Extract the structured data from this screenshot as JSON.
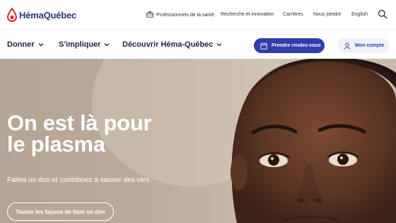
{
  "brand": {
    "name": "HémaQuébec",
    "color": "#23357e",
    "accent": "#d72638"
  },
  "utility_nav": {
    "items": [
      {
        "label": "Professionnels de la santé",
        "icon": "briefcase-icon"
      },
      {
        "label": "Recherche et innovation"
      },
      {
        "label": "Carrières"
      },
      {
        "label": "Nous joindre"
      },
      {
        "label": "English"
      }
    ],
    "search_icon": "search-icon"
  },
  "main_nav": {
    "items": [
      {
        "label": "Donner"
      },
      {
        "label": "S'impliquer"
      },
      {
        "label": "Découvrir Héma-Québec"
      }
    ],
    "cta_label": "Prendre rendez-vous",
    "cta_color": "#2f3fa8",
    "account_label": "Mon compte"
  },
  "hero": {
    "title_line1": "On est là pour",
    "title_line2": "le plasma",
    "subtitle": "Faites un don et contribuez à sauver des vies.",
    "button_label": "Toutes les façons de faire un don"
  }
}
